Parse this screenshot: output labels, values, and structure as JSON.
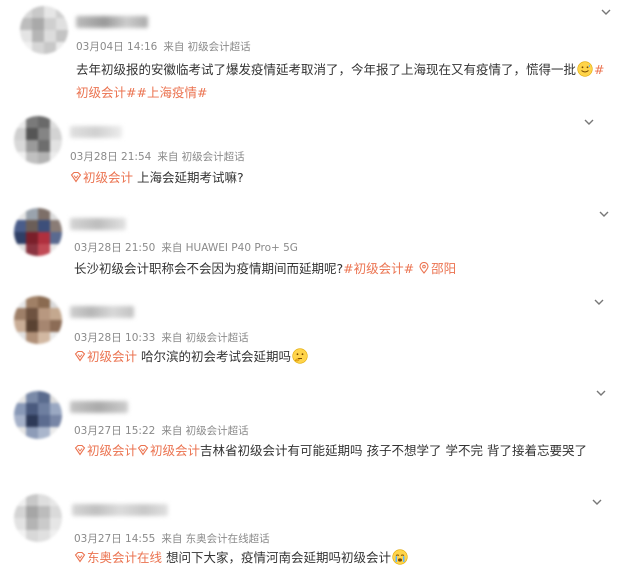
{
  "colors": {
    "accent": "#eb7350",
    "meta": "#8a8a8a",
    "text": "#333333"
  },
  "posts": [
    {
      "time": "03月04日 14:16",
      "source": "来自 初级会计超话",
      "text": "去年初级报的安徽临考试了爆发疫情延考取消了，今年报了上海现在又有疫情了，慌得一批",
      "emoji": "sweat-smile-emoji",
      "tags": [
        "#初级会计#",
        "#上海疫情#"
      ]
    },
    {
      "time": "03月28日 21:54",
      "source": "来自 初级会计超话",
      "topic": "初级会计",
      "text": "上海会延期考试嘛?"
    },
    {
      "time": "03月28日 21:50",
      "source": "来自 HUAWEI P40 Pro+ 5G",
      "text": "长沙初级会计职称会不会因为疫情期间而延期呢?",
      "tag": "#初级会计#",
      "location": "邵阳"
    },
    {
      "time": "03月28日 10:33",
      "source": "来自 初级会计超话",
      "topic": "初级会计",
      "text": "哈尔滨的初会考试会延期吗",
      "emoji": "thinking-emoji"
    },
    {
      "time": "03月27日 15:22",
      "source": "来自 初级会计超话",
      "topic1": "初级会计",
      "topic2": "初级会计",
      "text": "吉林省初级会计有可能延期吗 孩子不想学了 学不完 背了接着忘要哭了"
    },
    {
      "time": "03月27日 14:55",
      "source": "来自 东奥会计在线超话",
      "topic": "东奥会计在线",
      "text": "想问下大家，疫情河南会延期吗初级会计",
      "emoji": "crying-emoji"
    }
  ]
}
